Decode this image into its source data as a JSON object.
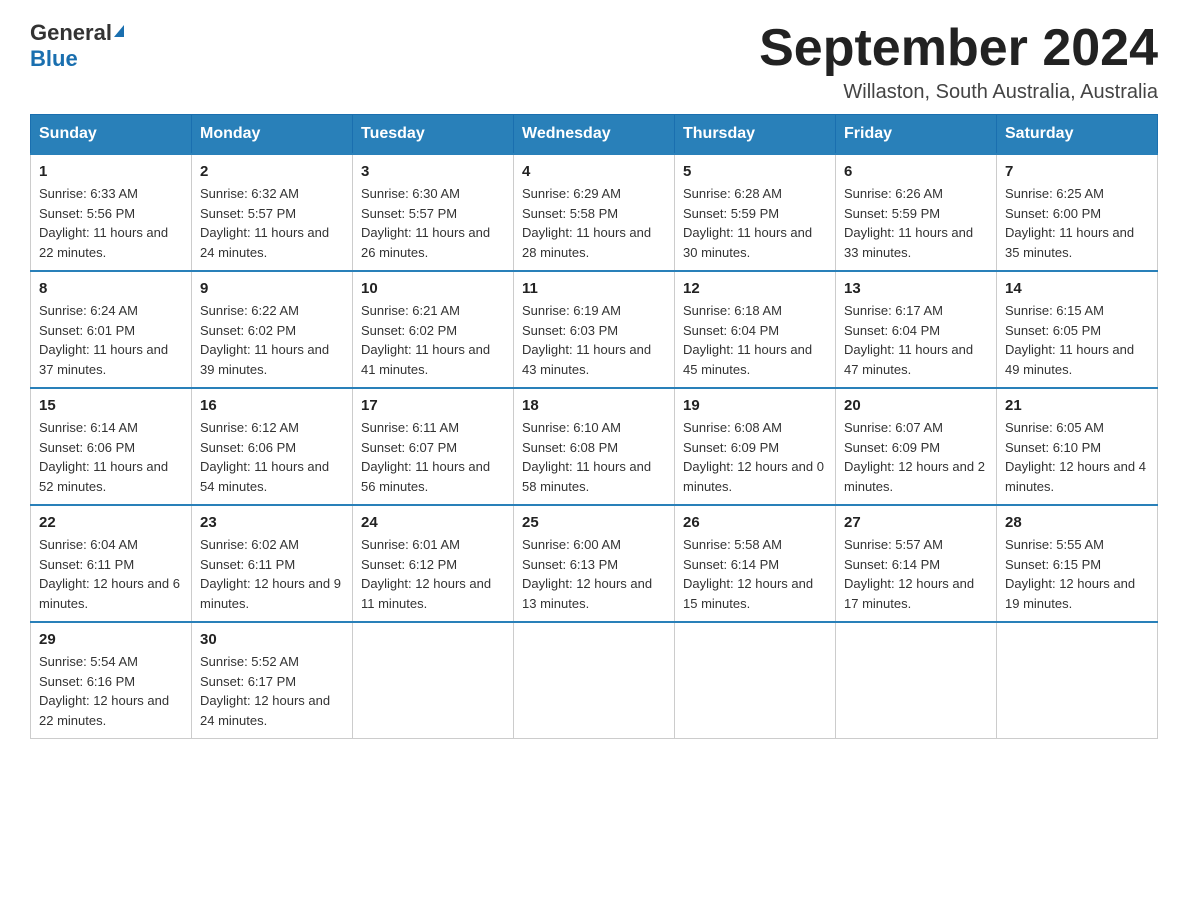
{
  "logo": {
    "general": "General",
    "blue": "Blue"
  },
  "title": "September 2024",
  "location": "Willaston, South Australia, Australia",
  "days_of_week": [
    "Sunday",
    "Monday",
    "Tuesday",
    "Wednesday",
    "Thursday",
    "Friday",
    "Saturday"
  ],
  "weeks": [
    [
      {
        "day": "1",
        "sunrise": "6:33 AM",
        "sunset": "5:56 PM",
        "daylight": "11 hours and 22 minutes."
      },
      {
        "day": "2",
        "sunrise": "6:32 AM",
        "sunset": "5:57 PM",
        "daylight": "11 hours and 24 minutes."
      },
      {
        "day": "3",
        "sunrise": "6:30 AM",
        "sunset": "5:57 PM",
        "daylight": "11 hours and 26 minutes."
      },
      {
        "day": "4",
        "sunrise": "6:29 AM",
        "sunset": "5:58 PM",
        "daylight": "11 hours and 28 minutes."
      },
      {
        "day": "5",
        "sunrise": "6:28 AM",
        "sunset": "5:59 PM",
        "daylight": "11 hours and 30 minutes."
      },
      {
        "day": "6",
        "sunrise": "6:26 AM",
        "sunset": "5:59 PM",
        "daylight": "11 hours and 33 minutes."
      },
      {
        "day": "7",
        "sunrise": "6:25 AM",
        "sunset": "6:00 PM",
        "daylight": "11 hours and 35 minutes."
      }
    ],
    [
      {
        "day": "8",
        "sunrise": "6:24 AM",
        "sunset": "6:01 PM",
        "daylight": "11 hours and 37 minutes."
      },
      {
        "day": "9",
        "sunrise": "6:22 AM",
        "sunset": "6:02 PM",
        "daylight": "11 hours and 39 minutes."
      },
      {
        "day": "10",
        "sunrise": "6:21 AM",
        "sunset": "6:02 PM",
        "daylight": "11 hours and 41 minutes."
      },
      {
        "day": "11",
        "sunrise": "6:19 AM",
        "sunset": "6:03 PM",
        "daylight": "11 hours and 43 minutes."
      },
      {
        "day": "12",
        "sunrise": "6:18 AM",
        "sunset": "6:04 PM",
        "daylight": "11 hours and 45 minutes."
      },
      {
        "day": "13",
        "sunrise": "6:17 AM",
        "sunset": "6:04 PM",
        "daylight": "11 hours and 47 minutes."
      },
      {
        "day": "14",
        "sunrise": "6:15 AM",
        "sunset": "6:05 PM",
        "daylight": "11 hours and 49 minutes."
      }
    ],
    [
      {
        "day": "15",
        "sunrise": "6:14 AM",
        "sunset": "6:06 PM",
        "daylight": "11 hours and 52 minutes."
      },
      {
        "day": "16",
        "sunrise": "6:12 AM",
        "sunset": "6:06 PM",
        "daylight": "11 hours and 54 minutes."
      },
      {
        "day": "17",
        "sunrise": "6:11 AM",
        "sunset": "6:07 PM",
        "daylight": "11 hours and 56 minutes."
      },
      {
        "day": "18",
        "sunrise": "6:10 AM",
        "sunset": "6:08 PM",
        "daylight": "11 hours and 58 minutes."
      },
      {
        "day": "19",
        "sunrise": "6:08 AM",
        "sunset": "6:09 PM",
        "daylight": "12 hours and 0 minutes."
      },
      {
        "day": "20",
        "sunrise": "6:07 AM",
        "sunset": "6:09 PM",
        "daylight": "12 hours and 2 minutes."
      },
      {
        "day": "21",
        "sunrise": "6:05 AM",
        "sunset": "6:10 PM",
        "daylight": "12 hours and 4 minutes."
      }
    ],
    [
      {
        "day": "22",
        "sunrise": "6:04 AM",
        "sunset": "6:11 PM",
        "daylight": "12 hours and 6 minutes."
      },
      {
        "day": "23",
        "sunrise": "6:02 AM",
        "sunset": "6:11 PM",
        "daylight": "12 hours and 9 minutes."
      },
      {
        "day": "24",
        "sunrise": "6:01 AM",
        "sunset": "6:12 PM",
        "daylight": "12 hours and 11 minutes."
      },
      {
        "day": "25",
        "sunrise": "6:00 AM",
        "sunset": "6:13 PM",
        "daylight": "12 hours and 13 minutes."
      },
      {
        "day": "26",
        "sunrise": "5:58 AM",
        "sunset": "6:14 PM",
        "daylight": "12 hours and 15 minutes."
      },
      {
        "day": "27",
        "sunrise": "5:57 AM",
        "sunset": "6:14 PM",
        "daylight": "12 hours and 17 minutes."
      },
      {
        "day": "28",
        "sunrise": "5:55 AM",
        "sunset": "6:15 PM",
        "daylight": "12 hours and 19 minutes."
      }
    ],
    [
      {
        "day": "29",
        "sunrise": "5:54 AM",
        "sunset": "6:16 PM",
        "daylight": "12 hours and 22 minutes."
      },
      {
        "day": "30",
        "sunrise": "5:52 AM",
        "sunset": "6:17 PM",
        "daylight": "12 hours and 24 minutes."
      },
      null,
      null,
      null,
      null,
      null
    ]
  ]
}
